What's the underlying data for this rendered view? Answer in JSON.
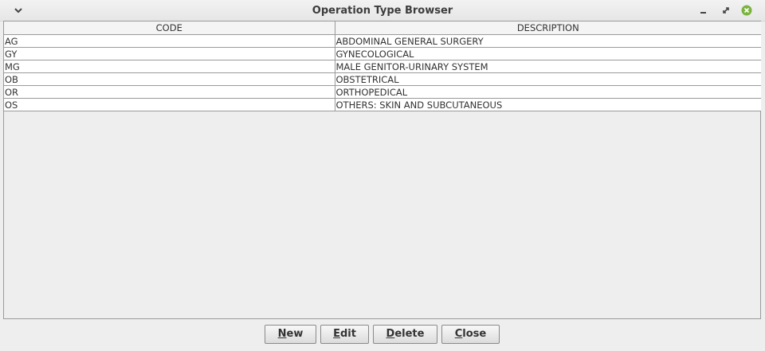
{
  "window": {
    "title": "Operation Type Browser",
    "controls": {
      "menu_icon": "chevron-down-icon",
      "minimize_icon": "minimize-icon",
      "maximize_icon": "maximize-icon",
      "close_icon": "close-icon",
      "close_color": "#7ab33e"
    }
  },
  "table": {
    "columns": [
      "CODE",
      "DESCRIPTION"
    ],
    "rows": [
      {
        "code": "AG",
        "description": "ABDOMINAL GENERAL SURGERY"
      },
      {
        "code": "GY",
        "description": "GYNECOLOGICAL"
      },
      {
        "code": "MG",
        "description": "MALE GENITOR-URINARY SYSTEM"
      },
      {
        "code": "OB",
        "description": "OBSTETRICAL"
      },
      {
        "code": "OR",
        "description": "ORTHOPEDICAL"
      },
      {
        "code": "OS",
        "description": "OTHERS: SKIN AND SUBCUTANEOUS"
      }
    ]
  },
  "buttons": {
    "new": {
      "mnemonic": "N",
      "rest": "ew"
    },
    "edit": {
      "mnemonic": "E",
      "rest": "dit"
    },
    "delete": {
      "mnemonic": "D",
      "rest": "elete"
    },
    "close": {
      "mnemonic": "C",
      "rest": "lose"
    }
  }
}
